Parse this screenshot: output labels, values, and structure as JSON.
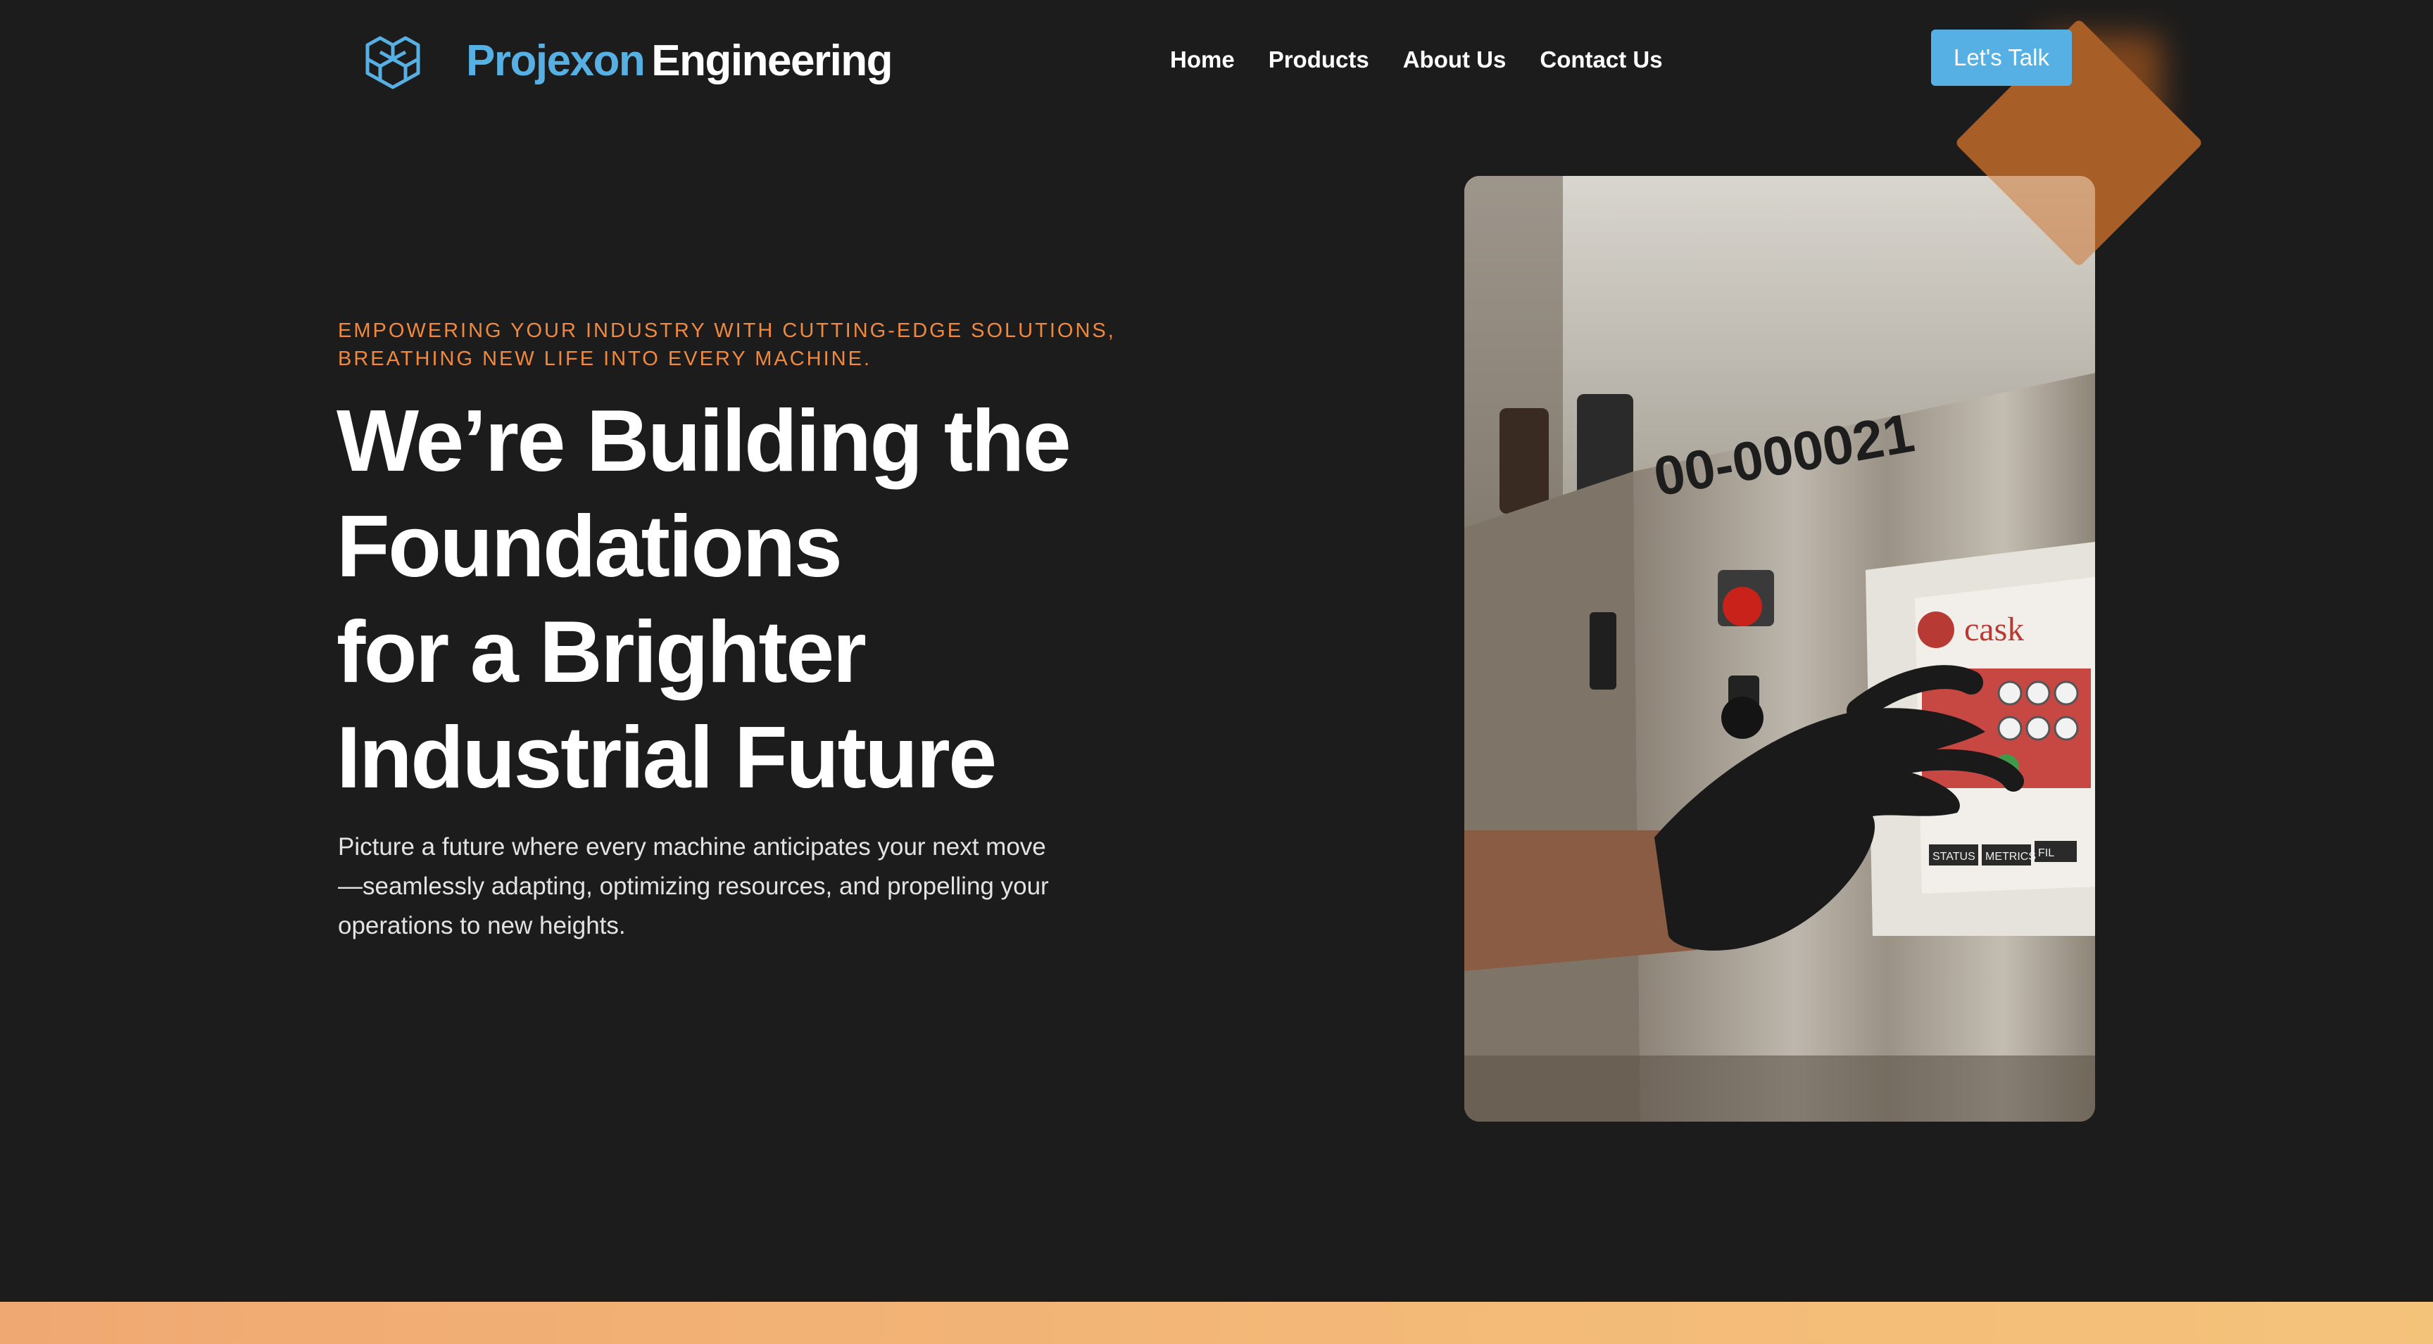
{
  "header": {
    "brand_primary": "Projexon",
    "brand_secondary": "Engineering",
    "nav": [
      "Home",
      "Products",
      "About Us",
      "Contact Us"
    ],
    "cta_label": "Let's Talk"
  },
  "hero": {
    "eyebrow": "Empowering your industry with cutting-edge solutions, breathing new life into every machine.",
    "headline_lines": [
      "We’re Building the",
      "Foundations",
      "for a Brighter",
      "Industrial Future"
    ],
    "description": "Picture a future where every machine anticipates your next move—seamlessly adapting, optimizing resources, and propelling your operations to new heights.",
    "photo_label": "00-000021",
    "screen_brand": "cask",
    "screen_tabs": [
      "STATUS",
      "METRICS",
      "FIL"
    ]
  },
  "colors": {
    "background": "#1c1c1c",
    "brand_blue": "#56b0e3",
    "accent_orange": "#f0883e",
    "diamond": "#7a3e16",
    "band_start": "#f0a872",
    "band_end": "#f4c37a"
  },
  "icons": {
    "logo": "hexagon-cubes-icon"
  }
}
